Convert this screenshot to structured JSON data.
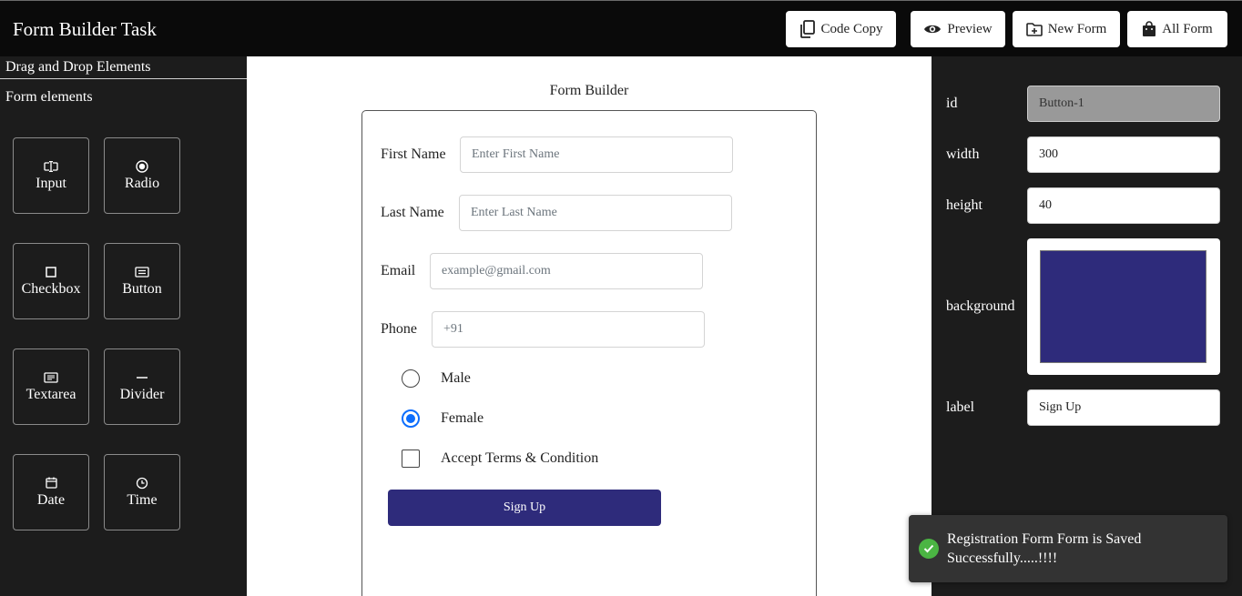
{
  "header": {
    "title": "Form Builder Task",
    "buttons": {
      "code_copy": "Code Copy",
      "preview": "Preview",
      "new_form": "New Form",
      "all_form": "All Form"
    }
  },
  "sidebar": {
    "heading": "Drag and Drop Elements",
    "subheading": "Form elements",
    "elements": [
      {
        "label": "Input",
        "icon": "input-cursor-icon"
      },
      {
        "label": "Radio",
        "icon": "radio-icon"
      },
      {
        "label": "Checkbox",
        "icon": "checkbox-icon"
      },
      {
        "label": "Button",
        "icon": "button-icon"
      },
      {
        "label": "Textarea",
        "icon": "textarea-icon"
      },
      {
        "label": "Divider",
        "icon": "divider-icon"
      },
      {
        "label": "Date",
        "icon": "calendar-icon"
      },
      {
        "label": "Time",
        "icon": "clock-icon"
      }
    ]
  },
  "canvas": {
    "title": "Form Builder",
    "fields": {
      "first_name": {
        "label": "First Name",
        "placeholder": "Enter First Name"
      },
      "last_name": {
        "label": "Last Name",
        "placeholder": "Enter Last Name"
      },
      "email": {
        "label": "Email",
        "placeholder": "example@gmail.com"
      },
      "phone": {
        "label": "Phone",
        "placeholder": "+91"
      }
    },
    "gender": {
      "male": {
        "label": "Male",
        "checked": false
      },
      "female": {
        "label": "Female",
        "checked": true
      }
    },
    "terms": {
      "label": "Accept Terms & Condition",
      "checked": false
    },
    "submit": {
      "label": "Sign Up",
      "color": "#2e2b7b"
    }
  },
  "properties": {
    "id": {
      "label": "id",
      "value": "Button-1"
    },
    "width": {
      "label": "width",
      "value": "300"
    },
    "height": {
      "label": "height",
      "value": "40"
    },
    "background": {
      "label": "background",
      "value": "#2e2b7b"
    },
    "label": {
      "label": "label",
      "value": "Sign Up"
    }
  },
  "toast": {
    "message": "Registration Form Form is Saved Successfully.....!!!!",
    "status": "success",
    "color": "#4bb543"
  }
}
